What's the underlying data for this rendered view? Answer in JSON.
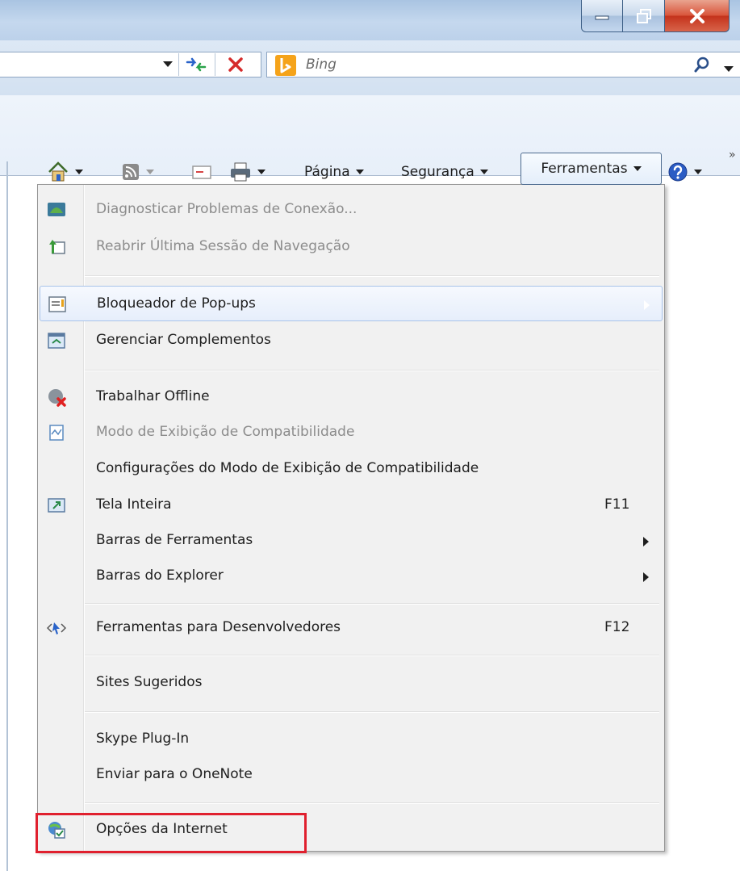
{
  "window": {
    "buttons": [
      "minimize",
      "maximize",
      "close"
    ]
  },
  "address_bar": {
    "search_provider": "Bing",
    "search_icon": "search-icon"
  },
  "command_bar": {
    "icons": [
      "home-icon",
      "rss-feed-icon",
      "mail-icon",
      "print-icon",
      "help-icon"
    ],
    "pagina": "Página",
    "seguranca": "Segurança",
    "ferramentas": "Ferramentas"
  },
  "menu": {
    "items": [
      {
        "label": "Diagnosticar Problemas de Conexão...",
        "icon": "network-diagnose-icon",
        "disabled": true
      },
      {
        "label": "Reabrir Última Sessão de Navegação",
        "icon": "reopen-session-icon",
        "disabled": true
      },
      {
        "label": "Bloqueador de Pop-ups",
        "icon": "popup-blocker-icon",
        "submenu": true,
        "hover": true
      },
      {
        "label": "Gerenciar Complementos",
        "icon": "addons-icon"
      },
      {
        "label": "Trabalhar Offline",
        "icon": "offline-icon"
      },
      {
        "label": "Modo de Exibição de Compatibilidade",
        "icon": "compatibility-icon",
        "disabled": true
      },
      {
        "label": "Configurações do Modo de Exibição de Compatibilidade"
      },
      {
        "label": "Tela Inteira",
        "icon": "fullscreen-icon",
        "shortcut": "F11"
      },
      {
        "label": "Barras de Ferramentas",
        "submenu": true
      },
      {
        "label": "Barras do Explorer",
        "submenu": true
      },
      {
        "label": "Ferramentas para Desenvolvedores",
        "icon": "developer-tools-icon",
        "shortcut": "F12"
      },
      {
        "label": "Sites Sugeridos"
      },
      {
        "label": "Skype Plug-In"
      },
      {
        "label": "Enviar para o OneNote"
      },
      {
        "label": "Opções da Internet",
        "icon": "internet-options-icon",
        "highlighted": true
      }
    ]
  },
  "colors": {
    "highlight_box": "#e0202e",
    "menu_background": "#f1f1f1",
    "hover_border": "#a8c3ea",
    "disabled_text": "#8c8c8c"
  }
}
